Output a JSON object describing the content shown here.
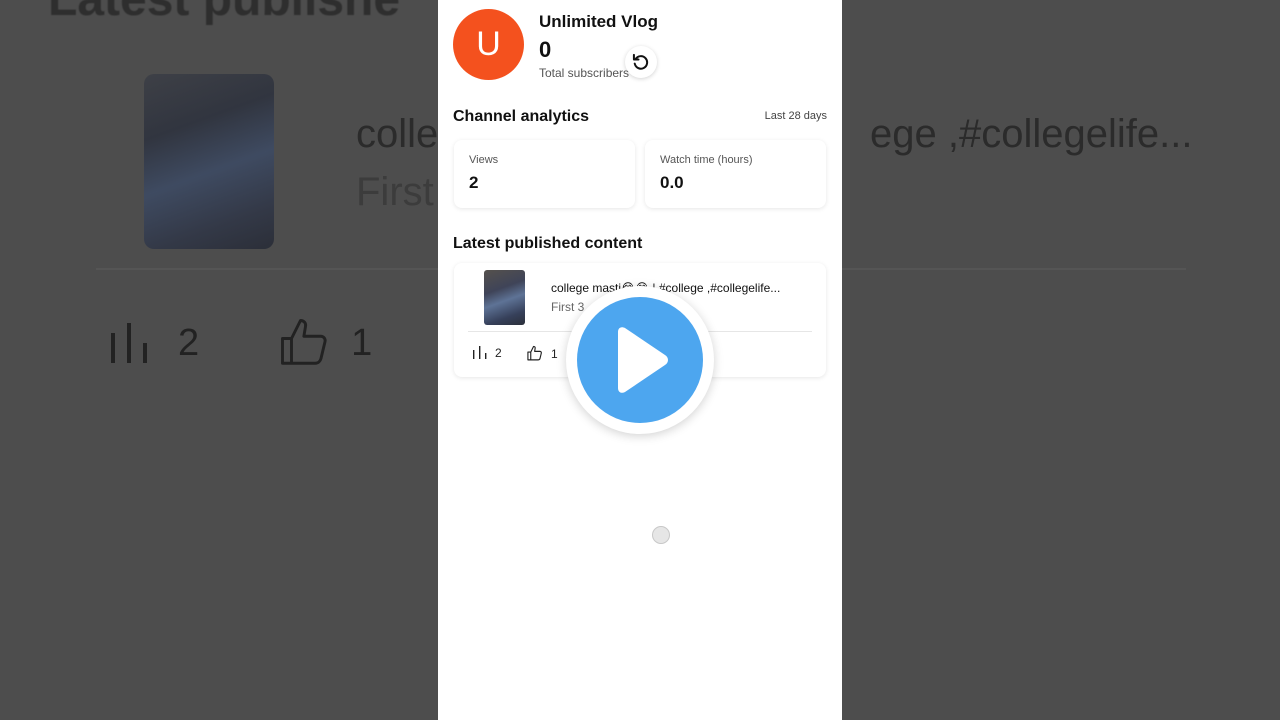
{
  "background": {
    "heading": "Latest publishe",
    "video_title_left": "colle",
    "video_title_right": "ege ,#collegelife...",
    "video_subtitle": "First",
    "views": "2",
    "likes": "1"
  },
  "channel": {
    "avatar_letter": "U",
    "name": "Unlimited Vlog",
    "subscriber_count": "0",
    "subscriber_label": "Total subscribers"
  },
  "analytics": {
    "title": "Channel analytics",
    "range": "Last 28 days",
    "views_label": "Views",
    "views_value": "2",
    "watch_label": "Watch time (hours)",
    "watch_value": "0.0"
  },
  "latest": {
    "title": "Latest published content",
    "video_title": "college masti😂😂 | #college ,#collegelife...",
    "video_subtitle": "First 3",
    "views": "2",
    "likes": "1"
  },
  "colors": {
    "avatar": "#f4511e",
    "play_button": "#4da6ef",
    "overlay": "#4d4d4d"
  },
  "icons": [
    "refresh-icon",
    "views-bar-icon",
    "thumbs-up-icon",
    "play-icon"
  ]
}
